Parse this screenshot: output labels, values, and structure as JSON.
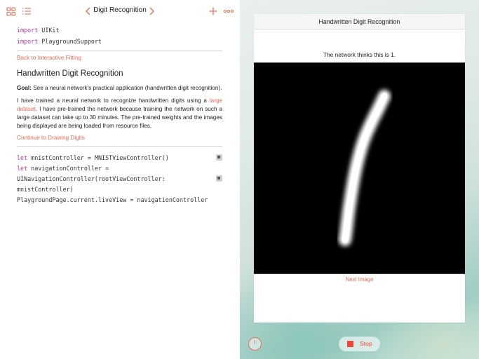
{
  "toolbar": {
    "title": "Digit Recognition",
    "icons": [
      "grid-icon",
      "list-icon",
      "chevron-left-icon",
      "chevron-right-icon",
      "plus-icon",
      "more-icon"
    ]
  },
  "code_top": {
    "line1_kw": "import",
    "line1_rest": " UIKit",
    "line2_kw": "import",
    "line2_rest": " PlaygroundSupport"
  },
  "content": {
    "back_link": "Back to Interactive Fitting",
    "heading": "Handwritten Digit Recognition",
    "goal_label": "Goal:",
    "goal_text": " See a neural network's practical application (handwritten digit recognition).",
    "para_part1": "I have trained a neural network to recognize handwritten digits using a ",
    "para_link": "large dataset",
    "para_part2": ". I have pre-trained the network because training the network on such a large dataset can take up to 30 minutes. The pre-trained weights and the images being displayed are being loaded from resource files.",
    "continue_link": "Continue to Drawing Digits"
  },
  "code_bottom": {
    "l1_kw": "let",
    "l1_rest": " mnistController = MNISTViewController()",
    "l2_kw": "let",
    "l2_rest": " navigationController =",
    "l3": " UINavigationController(rootViewController:",
    "l4": " mnistController)",
    "l5": "PlaygroundPage.current.liveView = navigationController"
  },
  "live_view": {
    "nav_title": "Handwritten Digit Recognition",
    "verdict": "The network thinks this is 1.",
    "next_label": "Next Image",
    "stop_label": "Stop"
  },
  "colors": {
    "accent": "#f06a52",
    "keyword": "#b936a8",
    "stop": "#f0463a"
  }
}
